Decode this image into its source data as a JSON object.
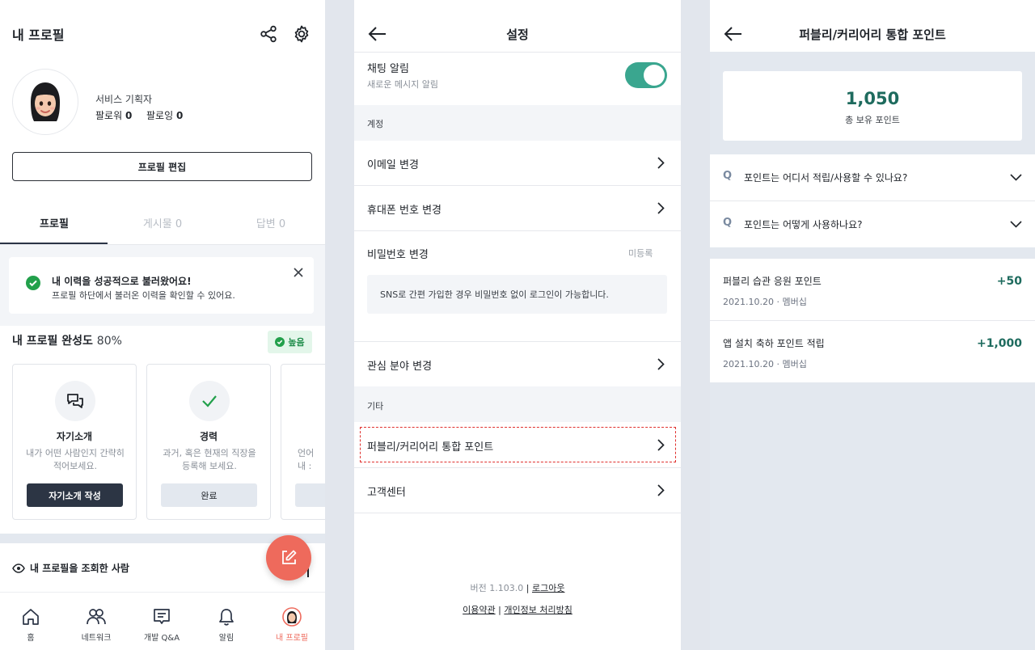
{
  "profile": {
    "title": "내 프로필",
    "job": "서비스 기획자",
    "followers_label": "팔로워",
    "followers": "0",
    "following_label": "팔로잉",
    "following": "0",
    "edit_button": "프로필 편집",
    "tabs": [
      {
        "label": "프로필",
        "active": true
      },
      {
        "label": "게시물 0",
        "active": false
      },
      {
        "label": "답변 0",
        "active": false
      }
    ],
    "toast": {
      "title": "내 이력을 성공적으로 불러왔어요!",
      "subtitle": "프로필 하단에서 불러온 이력을 확인할 수 있어요."
    },
    "completion_label": "내 프로필 완성도",
    "completion_value": "80%",
    "completion_badge": "높음",
    "cards": [
      {
        "title": "자기소개",
        "desc1": "내가 어떤 사람인지 간략히",
        "desc2": "적어보세요.",
        "button": "자기소개 작성",
        "icon": "chat-bubbles-icon",
        "primary": true
      },
      {
        "title": "경력",
        "desc1": "과거, 혹은 현재의 직장을",
        "desc2": "등록해 보세요.",
        "button": "완료",
        "icon": "check-icon",
        "primary": false
      },
      {
        "title": "",
        "desc1": "언어",
        "desc2": "내 :",
        "button": "",
        "icon": "",
        "primary": false
      }
    ],
    "viewers_label": "내 프로필을 조회한 사람",
    "nav": [
      {
        "label": "홈",
        "icon": "home-icon",
        "active": false
      },
      {
        "label": "네트워크",
        "icon": "people-icon",
        "active": false
      },
      {
        "label": "개발 Q&A",
        "icon": "qa-icon",
        "active": false
      },
      {
        "label": "알림",
        "icon": "bell-icon",
        "active": false
      },
      {
        "label": "내 프로필",
        "icon": "avatar-icon",
        "active": true
      }
    ],
    "accent": "#ee6a5c"
  },
  "settings": {
    "title": "설정",
    "chat_alert": {
      "label": "채팅 알림",
      "sub": "새로운 메시지 알림",
      "on": true
    },
    "section_account": "계정",
    "email": "이메일 변경",
    "phone": "휴대폰 번호 변경",
    "password": "비밀번호 변경",
    "password_status": "미등록",
    "password_note": "SNS로 간편 가입한 경우 비밀번호 없이 로그인이 가능합니다.",
    "interest": "관심 분야 변경",
    "section_etc": "기타",
    "points": "퍼블리/커리어리 통합 포인트",
    "support": "고객센터",
    "version": "버전 1.103.0",
    "logout": "로그아웃",
    "terms": "이용약관",
    "privacy": "개인정보 처리방침",
    "toggle_color": "#3aa68f"
  },
  "points": {
    "title": "퍼블리/커리어리 통합 포인트",
    "total": "1,050",
    "total_label": "총 보유 포인트",
    "faq": [
      {
        "q": "Q",
        "text": "포인트는 어디서 적립/사용할 수 있나요?"
      },
      {
        "q": "Q",
        "text": "포인트는 어떻게 사용하나요?"
      }
    ],
    "history": [
      {
        "title": "퍼블리 습관 응원 포인트",
        "date": "2021.10.20 · 멤버십",
        "value": "+50"
      },
      {
        "title": "앱 설치 축하 포인트 적립",
        "date": "2021.10.20 · 멤버십",
        "value": "+1,000"
      }
    ],
    "accent": "#1e6b5e"
  }
}
